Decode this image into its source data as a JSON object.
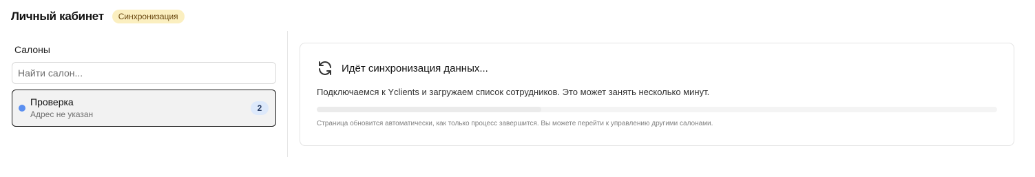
{
  "header": {
    "title": "Личный кабинет",
    "status_badge": "Синхронизация"
  },
  "sidebar": {
    "heading": "Салоны",
    "search": {
      "placeholder": "Найти салон...",
      "value": ""
    },
    "salons": [
      {
        "name": "Проверка",
        "address": "Адрес не указан",
        "count": "2",
        "dot_color": "#5b8ff0",
        "selected": true
      }
    ]
  },
  "sync": {
    "icon": "refresh-icon",
    "title": "Идёт синхронизация данных...",
    "description": "Подключаемся к Yclients и загружаем список сотрудников. Это может занять несколько минут.",
    "progress": 0.33,
    "note": "Страница обновится автоматически, как только процесс завершится. Вы можете перейти к управлению другими салонами."
  },
  "colors": {
    "badge_bg": "#fbefc0",
    "accent": "#5b8ff0"
  }
}
